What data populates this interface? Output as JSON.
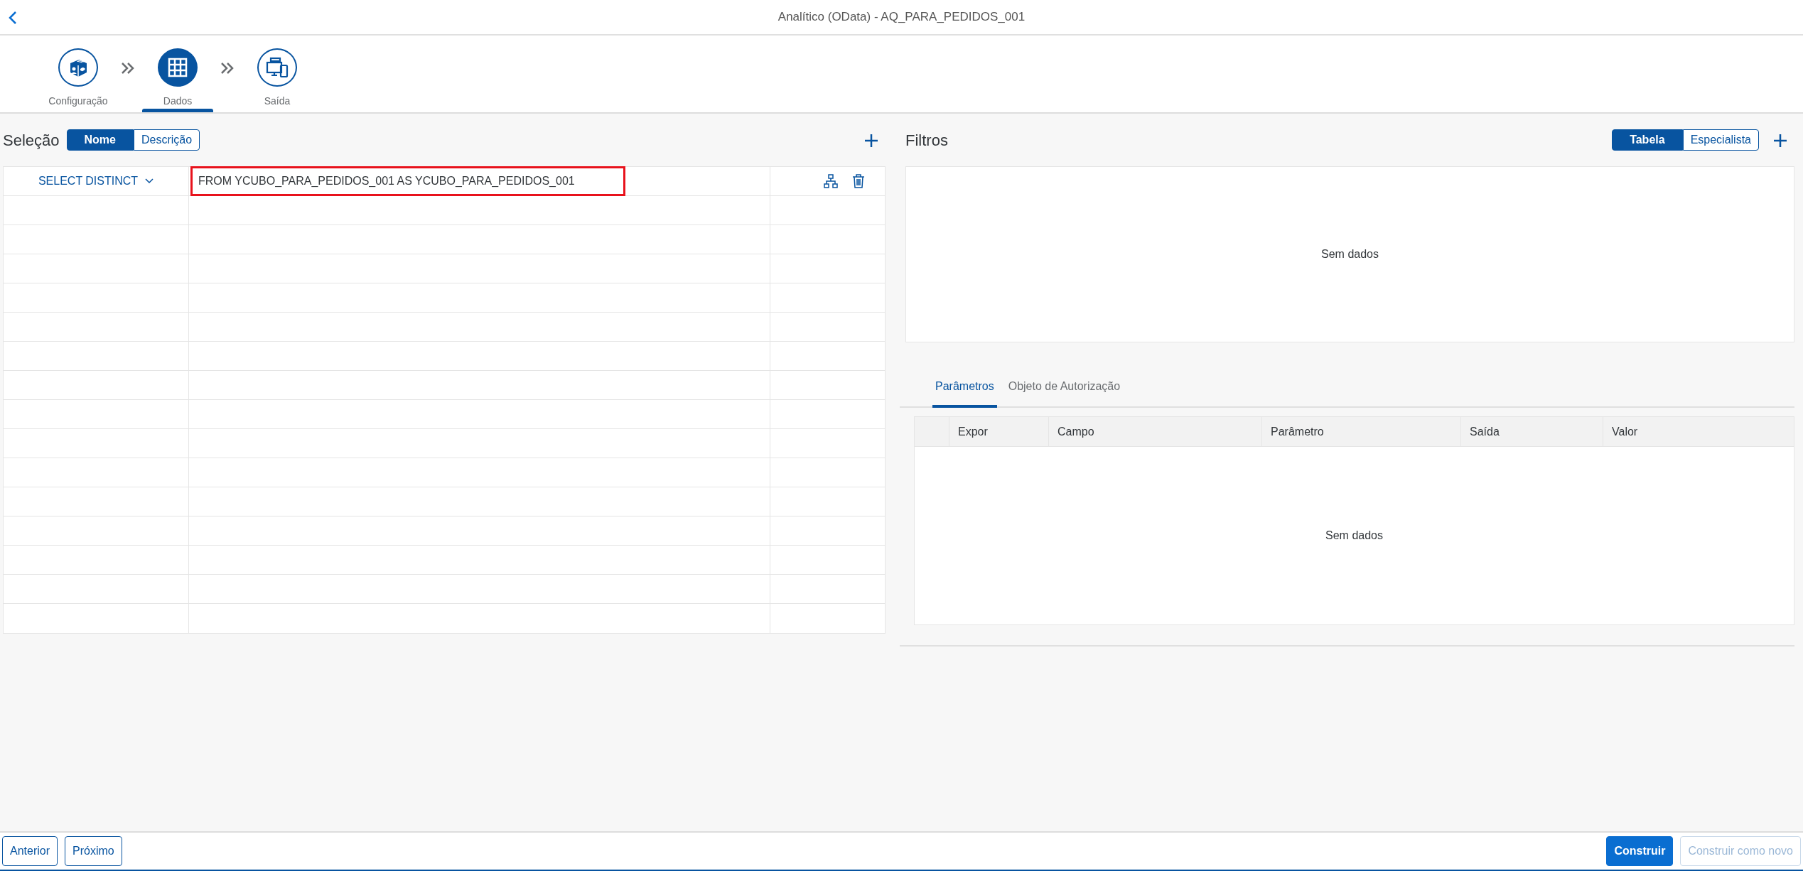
{
  "header": {
    "title": "Analítico (OData) - AQ_PARA_PEDIDOS_001"
  },
  "steps": [
    {
      "label": "Configuração",
      "selected": false
    },
    {
      "label": "Dados",
      "selected": true
    },
    {
      "label": "Saída",
      "selected": false
    }
  ],
  "selection": {
    "title": "Seleção",
    "toggle": [
      {
        "label": "Nome",
        "selected": true
      },
      {
        "label": "Descrição",
        "selected": false
      }
    ],
    "rows": [
      {
        "clause": "SELECT DISTINCT",
        "source": "FROM YCUBO_PARA_PEDIDOS_001 AS YCUBO_PARA_PEDIDOS_001",
        "highlighted": true
      }
    ]
  },
  "filters": {
    "title": "Filtros",
    "toggle": [
      {
        "label": "Tabela",
        "selected": true
      },
      {
        "label": "Especialista",
        "selected": false
      }
    ],
    "empty_text": "Sem dados"
  },
  "tabs": [
    {
      "label": "Parâmetros",
      "selected": true
    },
    {
      "label": "Objeto de Autorização",
      "selected": false
    }
  ],
  "params_table": {
    "columns": [
      "Expor",
      "Campo",
      "Parâmetro",
      "Saída",
      "Valor"
    ],
    "empty_text": "Sem dados"
  },
  "footer": {
    "nav_buttons": [
      {
        "label": "Anterior",
        "disabled": false
      },
      {
        "label": "Próximo",
        "disabled": false
      }
    ],
    "actions": [
      {
        "label": "Construir",
        "kind": "primary",
        "disabled": false
      },
      {
        "label": "Construir como novo",
        "kind": "outline",
        "disabled": true
      }
    ]
  }
}
